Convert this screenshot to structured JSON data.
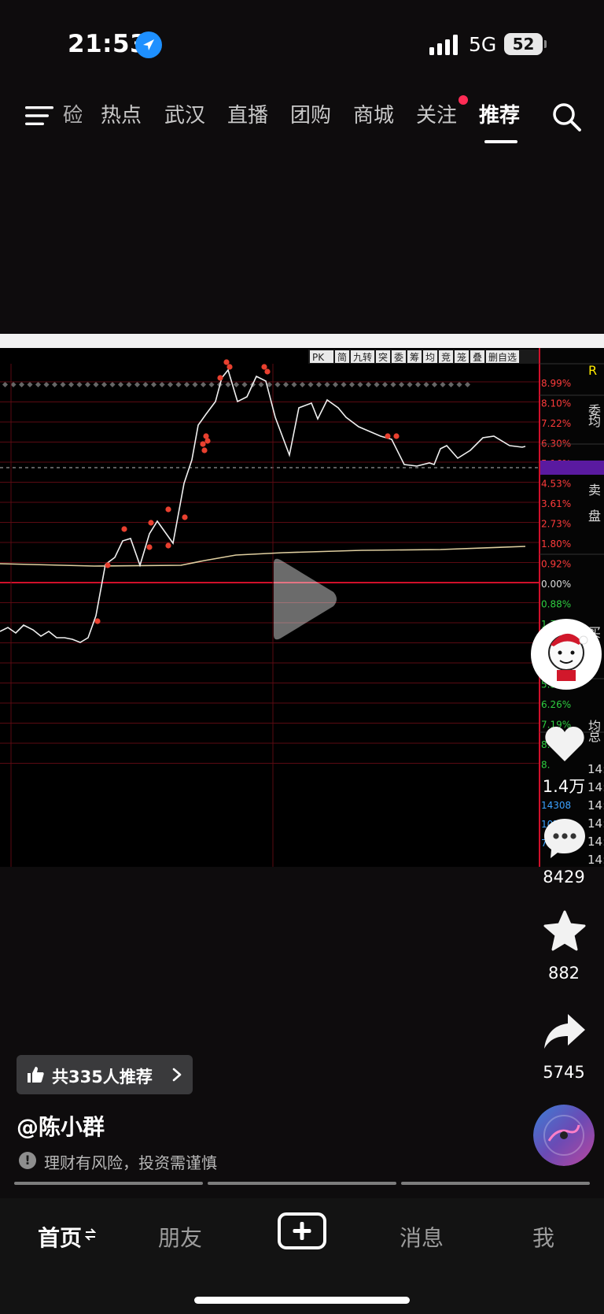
{
  "status_bar": {
    "time": "21:53",
    "network": "5G",
    "battery": "52"
  },
  "top_nav": {
    "tabs": [
      "硷",
      "热点",
      "武汉",
      "直播",
      "团购",
      "商城",
      "关注",
      "推荐"
    ],
    "active_tab": "推荐"
  },
  "video": {
    "chart_pct_labels": [
      "8.99%",
      "8.10%",
      "7.22%",
      "6.30%",
      "5.16%",
      "4.53%",
      "3.61%",
      "2.73%",
      "1.80%",
      "0.92%",
      "0.00%",
      "0.88%",
      "1.7",
      "2.",
      "4.",
      "5.38%",
      "6.26%",
      "7.19%",
      "8.07%",
      "8."
    ],
    "chart_vol_labels": [
      "14308",
      "10731",
      "7154"
    ],
    "toolbar_labels": [
      "PK",
      "简",
      "九转",
      "突",
      "委",
      "筹",
      "均",
      "竞",
      "笼",
      "叠",
      "删自选"
    ],
    "side_panel_labels": [
      "R",
      "委",
      "均",
      "卖",
      "盘",
      "买",
      "盘",
      "均",
      "总"
    ],
    "side_time_labels": [
      "14:",
      "14:",
      "14:",
      "14:",
      "14:",
      "14:"
    ]
  },
  "right_rail": {
    "like_count": "1.4万",
    "comment_count": "8429",
    "favorite_count": "882",
    "share_count": "5745"
  },
  "info": {
    "recommend_chip": "共335人推荐",
    "author": "@陈小群",
    "risk_notice": "理财有风险，投资需谨慎"
  },
  "tab_bar": {
    "home": "首页",
    "friends": "朋友",
    "messages": "消息",
    "me": "我"
  },
  "colors": {
    "accent_red": "#ff2c55",
    "chart_red": "#c0142a",
    "chart_green": "#2ecc40",
    "price_line": "#f0f0f0"
  }
}
